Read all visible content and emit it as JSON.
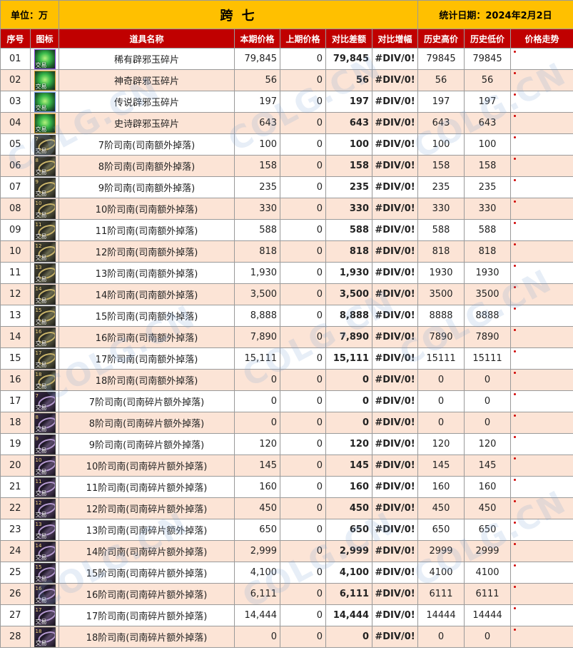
{
  "header": {
    "unit_label": "单位：万",
    "title": "跨 七",
    "date_label": "统计日期：2024年2月2日"
  },
  "columns": [
    "序号",
    "图标",
    "道具名称",
    "本期价格",
    "上期价格",
    "对比差额",
    "对比增幅",
    "历史高价",
    "历史低价",
    "价格走势"
  ],
  "watermark_text": "COLG.CN",
  "colors": {
    "header_bg": "#ffc000",
    "column_header_bg": "#c00000",
    "alt_row_bg": "#fce4d6",
    "emphasis_text": "#e00000"
  },
  "rows": [
    {
      "no": "01",
      "icon": "jade-fragment-icon",
      "icon_tag": "交易",
      "name": "稀有辟邪玉碎片",
      "current": "79,845",
      "previous": "0",
      "diff": "79,845",
      "pct": "#DIV/0!",
      "high": "79845",
      "low": "79845"
    },
    {
      "no": "02",
      "icon": "jade-fragment-icon",
      "icon_tag": "交易",
      "name": "神奇辟邪玉碎片",
      "current": "56",
      "previous": "0",
      "diff": "56",
      "pct": "#DIV/0!",
      "high": "56",
      "low": "56"
    },
    {
      "no": "03",
      "icon": "jade-fragment-icon",
      "icon_tag": "交易",
      "name": "传说辟邪玉碎片",
      "current": "197",
      "previous": "0",
      "diff": "197",
      "pct": "#DIV/0!",
      "high": "197",
      "low": "197"
    },
    {
      "no": "04",
      "icon": "jade-fragment-icon",
      "icon_tag": "交易",
      "name": "史诗辟邪玉碎片",
      "current": "643",
      "previous": "0",
      "diff": "643",
      "pct": "#DIV/0!",
      "high": "643",
      "low": "643"
    },
    {
      "no": "05",
      "icon": "sinan-compass-icon",
      "icon_tag": "交易",
      "icon_level": "7",
      "name": "7阶司南(司南额外掉落)",
      "current": "100",
      "previous": "0",
      "diff": "100",
      "pct": "#DIV/0!",
      "high": "100",
      "low": "100"
    },
    {
      "no": "06",
      "icon": "sinan-compass-icon",
      "icon_tag": "交易",
      "icon_level": "8",
      "name": "8阶司南(司南额外掉落)",
      "current": "158",
      "previous": "0",
      "diff": "158",
      "pct": "#DIV/0!",
      "high": "158",
      "low": "158"
    },
    {
      "no": "07",
      "icon": "sinan-compass-icon",
      "icon_tag": "交易",
      "icon_level": "9",
      "name": "9阶司南(司南额外掉落)",
      "current": "235",
      "previous": "0",
      "diff": "235",
      "pct": "#DIV/0!",
      "high": "235",
      "low": "235"
    },
    {
      "no": "08",
      "icon": "sinan-compass-icon",
      "icon_tag": "交易",
      "icon_level": "10",
      "name": "10阶司南(司南额外掉落)",
      "current": "330",
      "previous": "0",
      "diff": "330",
      "pct": "#DIV/0!",
      "high": "330",
      "low": "330"
    },
    {
      "no": "09",
      "icon": "sinan-compass-icon",
      "icon_tag": "交易",
      "icon_level": "11",
      "name": "11阶司南(司南额外掉落)",
      "current": "588",
      "previous": "0",
      "diff": "588",
      "pct": "#DIV/0!",
      "high": "588",
      "low": "588"
    },
    {
      "no": "10",
      "icon": "sinan-compass-icon",
      "icon_tag": "交易",
      "icon_level": "12",
      "name": "12阶司南(司南额外掉落)",
      "current": "818",
      "previous": "0",
      "diff": "818",
      "pct": "#DIV/0!",
      "high": "818",
      "low": "818"
    },
    {
      "no": "11",
      "icon": "sinan-compass-icon",
      "icon_tag": "交易",
      "icon_level": "13",
      "name": "13阶司南(司南额外掉落)",
      "current": "1,930",
      "previous": "0",
      "diff": "1,930",
      "pct": "#DIV/0!",
      "high": "1930",
      "low": "1930"
    },
    {
      "no": "12",
      "icon": "sinan-compass-icon",
      "icon_tag": "交易",
      "icon_level": "14",
      "name": "14阶司南(司南额外掉落)",
      "current": "3,500",
      "previous": "0",
      "diff": "3,500",
      "pct": "#DIV/0!",
      "high": "3500",
      "low": "3500"
    },
    {
      "no": "13",
      "icon": "sinan-compass-icon",
      "icon_tag": "交易",
      "icon_level": "15",
      "name": "15阶司南(司南额外掉落)",
      "current": "8,888",
      "previous": "0",
      "diff": "8,888",
      "pct": "#DIV/0!",
      "high": "8888",
      "low": "8888"
    },
    {
      "no": "14",
      "icon": "sinan-compass-icon",
      "icon_tag": "交易",
      "icon_level": "16",
      "name": "16阶司南(司南额外掉落)",
      "current": "7,890",
      "previous": "0",
      "diff": "7,890",
      "pct": "#DIV/0!",
      "high": "7890",
      "low": "7890"
    },
    {
      "no": "15",
      "icon": "sinan-compass-icon",
      "icon_tag": "交易",
      "icon_level": "17",
      "name": "17阶司南(司南额外掉落)",
      "current": "15,111",
      "previous": "0",
      "diff": "15,111",
      "pct": "#DIV/0!",
      "high": "15111",
      "low": "15111"
    },
    {
      "no": "16",
      "icon": "sinan-compass-icon",
      "icon_tag": "交易",
      "icon_level": "18",
      "name": "18阶司南(司南额外掉落)",
      "current": "0",
      "previous": "0",
      "diff": "0",
      "pct": "#DIV/0!",
      "high": "0",
      "low": "0"
    },
    {
      "no": "17",
      "icon": "sinan-fragment-icon",
      "icon_tag": "交易",
      "icon_level": "7",
      "name": "7阶司南(司南碎片额外掉落)",
      "current": "0",
      "previous": "0",
      "diff": "0",
      "pct": "#DIV/0!",
      "high": "0",
      "low": "0"
    },
    {
      "no": "18",
      "icon": "sinan-fragment-icon",
      "icon_tag": "交易",
      "icon_level": "8",
      "name": "8阶司南(司南碎片额外掉落)",
      "current": "0",
      "previous": "0",
      "diff": "0",
      "pct": "#DIV/0!",
      "high": "0",
      "low": "0"
    },
    {
      "no": "19",
      "icon": "sinan-fragment-icon",
      "icon_tag": "交易",
      "icon_level": "9",
      "name": "9阶司南(司南碎片额外掉落)",
      "current": "120",
      "previous": "0",
      "diff": "120",
      "pct": "#DIV/0!",
      "high": "120",
      "low": "120"
    },
    {
      "no": "20",
      "icon": "sinan-fragment-icon",
      "icon_tag": "交易",
      "icon_level": "10",
      "name": "10阶司南(司南碎片额外掉落)",
      "current": "145",
      "previous": "0",
      "diff": "145",
      "pct": "#DIV/0!",
      "high": "145",
      "low": "145"
    },
    {
      "no": "21",
      "icon": "sinan-fragment-icon",
      "icon_tag": "交易",
      "icon_level": "11",
      "name": "11阶司南(司南碎片额外掉落)",
      "current": "160",
      "previous": "0",
      "diff": "160",
      "pct": "#DIV/0!",
      "high": "160",
      "low": "160"
    },
    {
      "no": "22",
      "icon": "sinan-fragment-icon",
      "icon_tag": "交易",
      "icon_level": "12",
      "name": "12阶司南(司南碎片额外掉落)",
      "current": "450",
      "previous": "0",
      "diff": "450",
      "pct": "#DIV/0!",
      "high": "450",
      "low": "450"
    },
    {
      "no": "23",
      "icon": "sinan-fragment-icon",
      "icon_tag": "交易",
      "icon_level": "13",
      "name": "13阶司南(司南碎片额外掉落)",
      "current": "650",
      "previous": "0",
      "diff": "650",
      "pct": "#DIV/0!",
      "high": "650",
      "low": "650"
    },
    {
      "no": "24",
      "icon": "sinan-fragment-icon",
      "icon_tag": "交易",
      "icon_level": "14",
      "name": "14阶司南(司南碎片额外掉落)",
      "current": "2,999",
      "previous": "0",
      "diff": "2,999",
      "pct": "#DIV/0!",
      "high": "2999",
      "low": "2999"
    },
    {
      "no": "25",
      "icon": "sinan-fragment-icon",
      "icon_tag": "交易",
      "icon_level": "15",
      "name": "15阶司南(司南碎片额外掉落)",
      "current": "4,100",
      "previous": "0",
      "diff": "4,100",
      "pct": "#DIV/0!",
      "high": "4100",
      "low": "4100"
    },
    {
      "no": "26",
      "icon": "sinan-fragment-icon",
      "icon_tag": "交易",
      "icon_level": "16",
      "name": "16阶司南(司南碎片额外掉落)",
      "current": "6,111",
      "previous": "0",
      "diff": "6,111",
      "pct": "#DIV/0!",
      "high": "6111",
      "low": "6111"
    },
    {
      "no": "27",
      "icon": "sinan-fragment-icon",
      "icon_tag": "交易",
      "icon_level": "17",
      "name": "17阶司南(司南碎片额外掉落)",
      "current": "14,444",
      "previous": "0",
      "diff": "14,444",
      "pct": "#DIV/0!",
      "high": "14444",
      "low": "14444"
    },
    {
      "no": "28",
      "icon": "sinan-fragment-icon",
      "icon_tag": "交易",
      "icon_level": "18",
      "name": "18阶司南(司南碎片额外掉落)",
      "current": "0",
      "previous": "0",
      "diff": "0",
      "pct": "#DIV/0!",
      "high": "0",
      "low": "0"
    }
  ]
}
